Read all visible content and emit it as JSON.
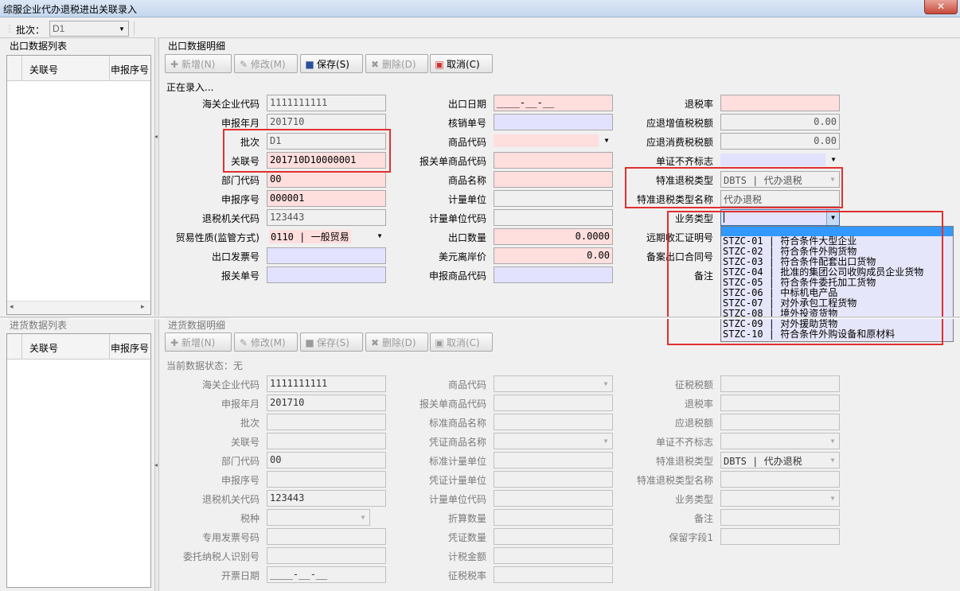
{
  "window": {
    "title": "综服企业代办退税进出关联录入",
    "close": "✕"
  },
  "toolbar": {
    "batch_label": "批次：",
    "batch_value": "D1"
  },
  "export_list": {
    "title": "出口数据列表",
    "cols": [
      "关联号",
      "申报序号"
    ]
  },
  "export_detail": {
    "title": "出口数据明细",
    "buttons": {
      "new": "新增(N)",
      "edit": "修改(M)",
      "save": "保存(S)",
      "delete": "删除(D)",
      "cancel": "取消(C)"
    },
    "status": "正在录入...",
    "col1": [
      {
        "label": "海关企业代码",
        "value": "1111111111"
      },
      {
        "label": "申报年月",
        "value": "201710"
      },
      {
        "label": "批次",
        "value": "D1"
      },
      {
        "label": "关联号",
        "value": "201710D10000001"
      },
      {
        "label": "部门代码",
        "value": "00"
      },
      {
        "label": "申报序号",
        "value": "000001"
      },
      {
        "label": "退税机关代码",
        "value": "123443"
      },
      {
        "label": "贸易性质(监管方式)",
        "value": "0110 | 一般贸易"
      },
      {
        "label": "出口发票号",
        "value": ""
      },
      {
        "label": "报关单号",
        "value": ""
      }
    ],
    "col2": [
      {
        "label": "出口日期",
        "value": "____-__-__"
      },
      {
        "label": "核销单号",
        "value": ""
      },
      {
        "label": "商品代码",
        "value": ""
      },
      {
        "label": "报关单商品代码",
        "value": ""
      },
      {
        "label": "商品名称",
        "value": ""
      },
      {
        "label": "计量单位",
        "value": ""
      },
      {
        "label": "计量单位代码",
        "value": ""
      },
      {
        "label": "出口数量",
        "value": "0.0000"
      },
      {
        "label": "美元离岸价",
        "value": "0.00"
      },
      {
        "label": "申报商品代码",
        "value": ""
      }
    ],
    "col3": [
      {
        "label": "退税率",
        "value": ""
      },
      {
        "label": "应退增值税税额",
        "value": "0.00"
      },
      {
        "label": "应退消费税税额",
        "value": "0.00"
      },
      {
        "label": "单证不齐标志",
        "value": ""
      },
      {
        "label": "特准退税类型",
        "value": "DBTS | 代办退税"
      },
      {
        "label": "特准退税类型名称",
        "value": "代办退税"
      },
      {
        "label": "业务类型",
        "value": ""
      },
      {
        "label": "远期收汇证明号",
        "value": ""
      },
      {
        "label": "备案出口合同号",
        "value": ""
      },
      {
        "label": "备注",
        "value": ""
      }
    ],
    "business_type_options": [
      {
        "code": "STZC-01",
        "name": "符合条件大型企业"
      },
      {
        "code": "STZC-02",
        "name": "符合条件外购货物"
      },
      {
        "code": "STZC-03",
        "name": "符合条件配套出口货物"
      },
      {
        "code": "STZC-04",
        "name": "批准的集团公司收购成员企业货物"
      },
      {
        "code": "STZC-05",
        "name": "符合条件委托加工货物"
      },
      {
        "code": "STZC-06",
        "name": "中标机电产品"
      },
      {
        "code": "STZC-07",
        "name": "对外承包工程货物"
      },
      {
        "code": "STZC-08",
        "name": "境外投资货物"
      },
      {
        "code": "STZC-09",
        "name": "对外援助货物"
      },
      {
        "code": "STZC-10",
        "name": "符合条件外购设备和原材料"
      }
    ]
  },
  "import_list": {
    "title": "进货数据列表",
    "cols": [
      "关联号",
      "申报序号"
    ]
  },
  "import_detail": {
    "title": "进货数据明细",
    "buttons": {
      "new": "新增(N)",
      "edit": "修改(M)",
      "save": "保存(S)",
      "delete": "删除(D)",
      "cancel": "取消(C)"
    },
    "status": "当前数据状态：无",
    "col1": [
      {
        "label": "海关企业代码",
        "value": "1111111111"
      },
      {
        "label": "申报年月",
        "value": "201710"
      },
      {
        "label": "批次",
        "value": ""
      },
      {
        "label": "关联号",
        "value": ""
      },
      {
        "label": "部门代码",
        "value": "00"
      },
      {
        "label": "申报序号",
        "value": ""
      },
      {
        "label": "退税机关代码",
        "value": "123443"
      },
      {
        "label": "税种",
        "value": ""
      },
      {
        "label": "专用发票号码",
        "value": ""
      },
      {
        "label": "委托纳税人识别号",
        "value": ""
      },
      {
        "label": "开票日期",
        "value": "____-__-__"
      }
    ],
    "col2": [
      {
        "label": "商品代码",
        "value": ""
      },
      {
        "label": "报关单商品代码",
        "value": ""
      },
      {
        "label": "标准商品名称",
        "value": ""
      },
      {
        "label": "凭证商品名称",
        "value": ""
      },
      {
        "label": "标准计量单位",
        "value": ""
      },
      {
        "label": "凭证计量单位",
        "value": ""
      },
      {
        "label": "计量单位代码",
        "value": ""
      },
      {
        "label": "折算数量",
        "value": ""
      },
      {
        "label": "凭证数量",
        "value": ""
      },
      {
        "label": "计税金额",
        "value": ""
      },
      {
        "label": "征税税率",
        "value": ""
      }
    ],
    "col3": [
      {
        "label": "征税税额",
        "value": ""
      },
      {
        "label": "退税率",
        "value": ""
      },
      {
        "label": "应退税额",
        "value": ""
      },
      {
        "label": "单证不齐标志",
        "value": ""
      },
      {
        "label": "特准退税类型",
        "value": "DBTS | 代办退税"
      },
      {
        "label": "特准退税类型名称",
        "value": ""
      },
      {
        "label": "业务类型",
        "value": ""
      },
      {
        "label": "备注",
        "value": ""
      },
      {
        "label": "保留字段1",
        "value": ""
      }
    ]
  },
  "colors": {
    "required": "#ffdede",
    "optional": "#e2e2ff",
    "highlight": "#e03030",
    "dropdown_bg": "#e6e6fa"
  }
}
